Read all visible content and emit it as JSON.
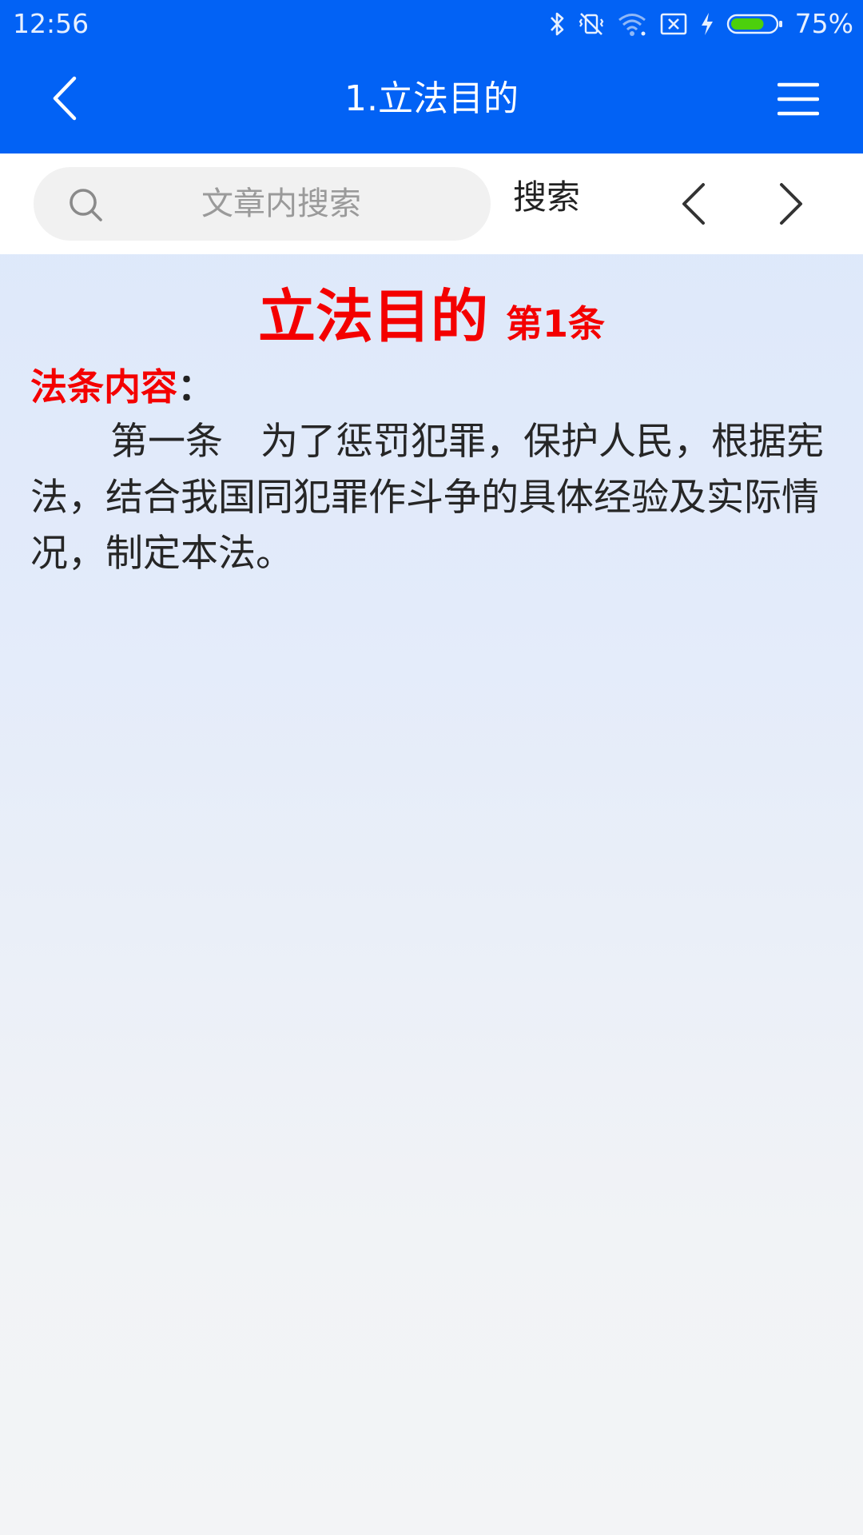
{
  "status_bar": {
    "time": "12:56",
    "battery_percent": "75%",
    "battery_level": 0.75,
    "icons": [
      "bluetooth-icon",
      "vibrate-off-icon",
      "wifi-icon",
      "sim-none-icon",
      "charging-icon",
      "battery-icon"
    ]
  },
  "app_bar": {
    "title": "1.立法目的",
    "back_icon": "chevron-left-icon",
    "menu_icon": "hamburger-menu-icon"
  },
  "search": {
    "placeholder": "文章内搜索",
    "value": "",
    "button_label": "搜索",
    "prev_icon": "chevron-left-icon",
    "next_icon": "chevron-right-icon"
  },
  "article": {
    "title": "立法目的",
    "number": "第1条",
    "section_label": "法条内容",
    "section_colon": "：",
    "body": "第一条　为了惩罚犯罪，保护人民，根据宪法，结合我国同犯罪作斗争的具体经验及实际情况，制定本法。"
  },
  "colors": {
    "primary": "#0262f5",
    "accent_red": "#f40000",
    "battery_green": "#4cd00c"
  }
}
